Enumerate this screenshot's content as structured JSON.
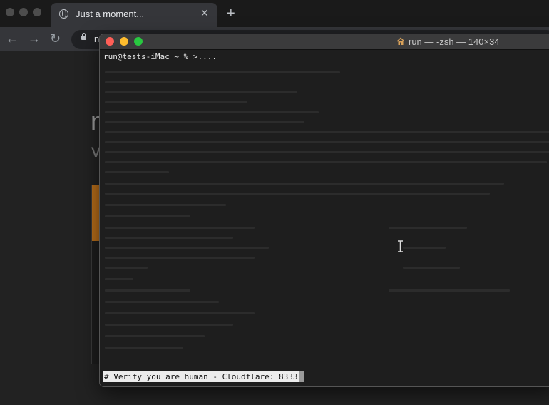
{
  "browser": {
    "tab": {
      "title": "Just a moment...",
      "close_glyph": "✕",
      "favicon": "globe-icon"
    },
    "new_tab_glyph": "+",
    "toolbar": {
      "back_glyph": "←",
      "forward_glyph": "→",
      "reload_glyph": "↻",
      "address_visible_text": "n"
    },
    "page": {
      "heading_visible": "n",
      "subheading_visible": "v",
      "accent_color": "#b86e1a"
    }
  },
  "terminal": {
    "title": "run — -zsh — 140×34",
    "title_icon": "home-icon",
    "prompt": "run@tests-iMac ~ % >....",
    "status_line": "# Verify you are human - Cloudflare: 8333",
    "traffic_colors": {
      "close": "#ff5f57",
      "minimize": "#febc2e",
      "zoom": "#28c840"
    }
  }
}
